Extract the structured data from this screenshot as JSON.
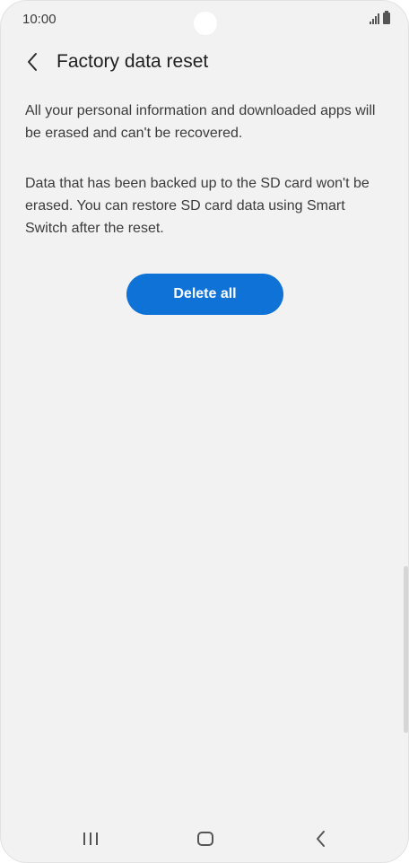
{
  "status_bar": {
    "time": "10:00",
    "icons": [
      "signal-icon",
      "battery-icon"
    ]
  },
  "header": {
    "back_icon": "chevron-left-icon",
    "title": "Factory data reset"
  },
  "main": {
    "paragraphs": [
      "All your personal information and downloaded apps will be erased and can't be recovered.",
      "Data that has been backed up to the SD card won't be erased. You can restore SD card data using Smart Switch after the reset."
    ],
    "delete_button_label": "Delete all"
  },
  "nav_bar": {
    "icons": [
      "recent-apps-icon",
      "home-icon",
      "back-icon"
    ]
  },
  "colors": {
    "accent": "#0f72d6",
    "background": "#f2f2f2"
  }
}
